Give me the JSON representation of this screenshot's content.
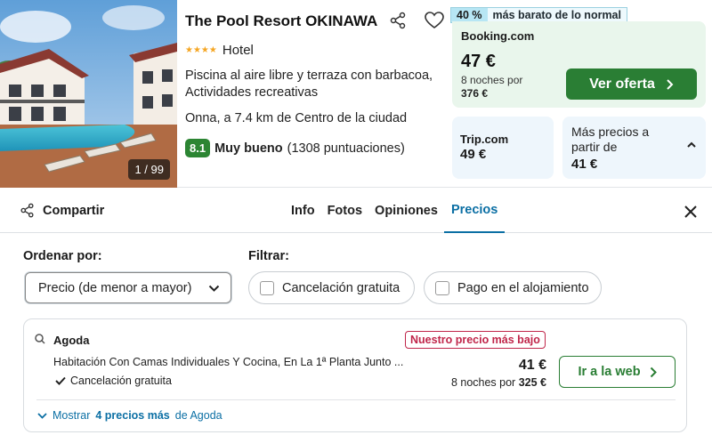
{
  "hotel": {
    "name": "The Pool Resort OKINAWA",
    "stars": "★★★★",
    "type": "Hotel",
    "amenities": "Piscina al aire libre y terraza con barbacoa, Actividades recreativas",
    "location": "Onna, a 7.4 km de Centro de la ciudad",
    "score": "8.1",
    "score_label": "Muy bueno",
    "reviews": "(1308 puntuaciones)",
    "photo_counter": "1 / 99"
  },
  "deal": {
    "percent": "40 %",
    "text": "más barato de lo normal",
    "provider": "Booking.com",
    "price": "47 €",
    "nights": "8 noches por",
    "total": "376 €",
    "cta": "Ver oferta"
  },
  "alternatives": {
    "trip_name": "Trip.com",
    "trip_price": "49 €",
    "more_label": "Más precios a partir de",
    "more_price": "41 €"
  },
  "tabbar": {
    "share": "Compartir",
    "tabs": [
      "Info",
      "Fotos",
      "Opiniones",
      "Precios"
    ],
    "active_tab": "Precios"
  },
  "filters": {
    "sort_label": "Ordenar por:",
    "sort_value": "Precio (de menor a mayor)",
    "filter_label": "Filtrar:",
    "chip_free": "Cancelación gratuita",
    "chip_pay": "Pago en el alojamiento"
  },
  "result": {
    "provider": "Agoda",
    "badge": "Nuestro precio más bajo",
    "room": "Habitación Con Camas Individuales Y Cocina, En La 1ª Planta Junto ...",
    "cancellation": "Cancelación gratuita",
    "price": "41 €",
    "nights": "8 noches por",
    "total": "325 €",
    "cta": "Ir a la web",
    "show_more_prefix": "Mostrar",
    "show_more_count": "4 precios más",
    "show_more_suffix": "de Agoda"
  },
  "colors": {
    "brand_green": "#2a7e34",
    "link_blue": "#0b6fa4",
    "deal_bg": "#e9f6ec",
    "badge_red": "#c0264a"
  }
}
